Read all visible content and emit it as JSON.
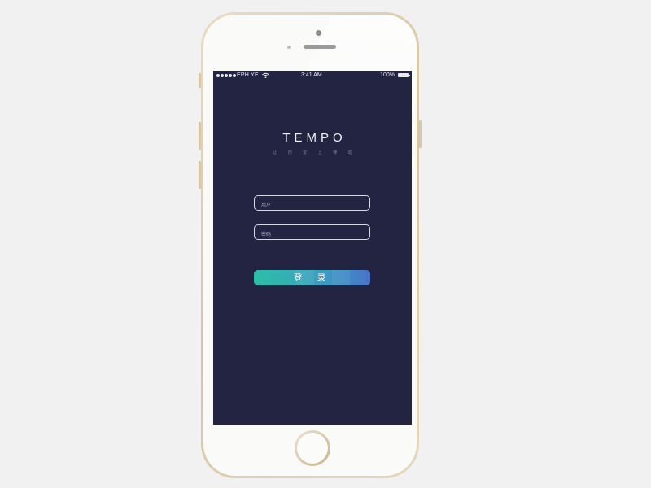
{
  "status_bar": {
    "carrier": "EPH.YE",
    "time": "3:41 AM",
    "battery_percent": "100%",
    "signal_bars": 5,
    "wifi_icon": "wifi-icon",
    "battery_icon": "battery-icon"
  },
  "app": {
    "title": "TEMPO",
    "tagline": "让 你 爱 上 律 动"
  },
  "login_form": {
    "username_placeholder": "用户",
    "password_placeholder": "密码",
    "login_label": "登录"
  },
  "colors": {
    "screen_background": "#222442",
    "button_gradient_start": "#2bbfa6",
    "button_gradient_end": "#4a74c8",
    "field_border": "#d8d9e6",
    "phone_frame": "#e2d3b6",
    "page_background": "#f1f1f1"
  }
}
